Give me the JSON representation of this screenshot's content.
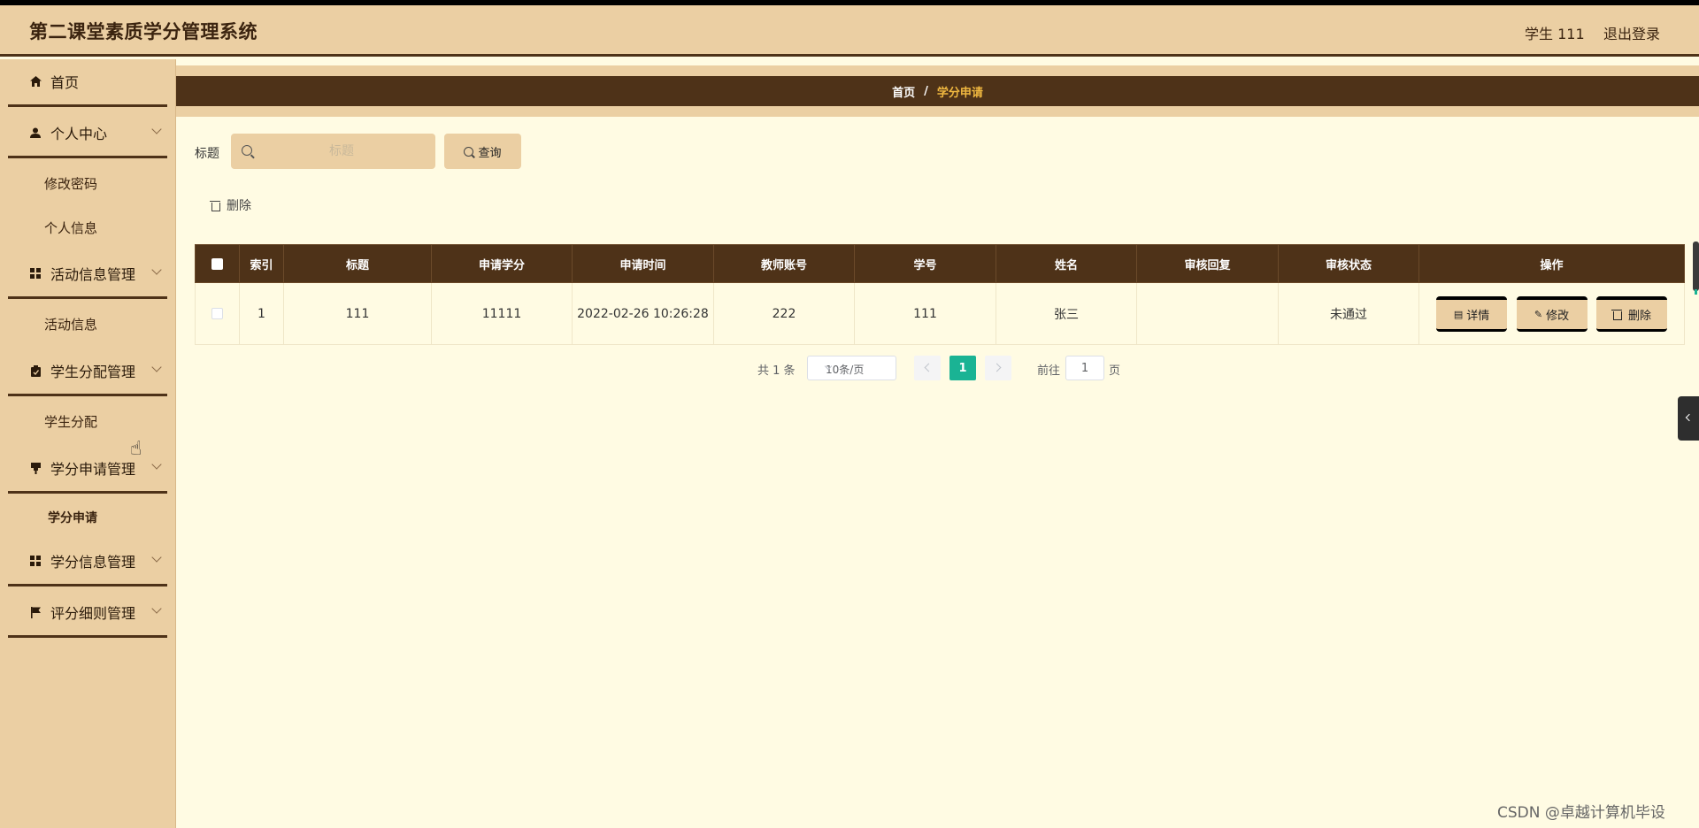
{
  "header": {
    "title": "第二课堂素质学分管理系统",
    "user": "学生 111",
    "logout": "退出登录"
  },
  "sidebar": {
    "home": "首页",
    "personal_center": "个人中心",
    "change_password": "修改密码",
    "personal_info": "个人信息",
    "activity_mgmt": "活动信息管理",
    "activity_info": "活动信息",
    "student_assign_mgmt": "学生分配管理",
    "student_assign": "学生分配",
    "credit_apply_mgmt": "学分申请管理",
    "credit_apply": "学分申请",
    "credit_info_mgmt": "学分信息管理",
    "rules_mgmt": "评分细则管理"
  },
  "breadcrumb": {
    "home": "首页",
    "sep": "/",
    "current": "学分申请"
  },
  "search": {
    "label": "标题",
    "placeholder": "标题",
    "query_button": "查询"
  },
  "toolbar": {
    "delete": "删除"
  },
  "table": {
    "headers": [
      "索引",
      "标题",
      "申请学分",
      "申请时间",
      "教师账号",
      "学号",
      "姓名",
      "审核回复",
      "审核状态",
      "操作"
    ],
    "rows": [
      {
        "index": "1",
        "title": "111",
        "credits": "11111",
        "time": "2022-02-26 10:26:28",
        "teacher": "222",
        "student_no": "111",
        "name": "张三",
        "reply": "",
        "status": "未通过"
      }
    ],
    "actions": {
      "detail": "详情",
      "edit": "修改",
      "delete": "删除"
    }
  },
  "pagination": {
    "total": "共 1 条",
    "page_size": "10条/页",
    "current_page": "1",
    "goto_label": "前往",
    "goto_value": "1",
    "page_suffix": "页"
  },
  "watermark": "CSDN @卓越计算机毕设",
  "colors": {
    "header_bg": "#ebcfa3",
    "dark_brown": "#4e3218",
    "content_bg": "#fffbe3",
    "accent_gold": "#f0b840",
    "pager_active": "#1ab394"
  }
}
